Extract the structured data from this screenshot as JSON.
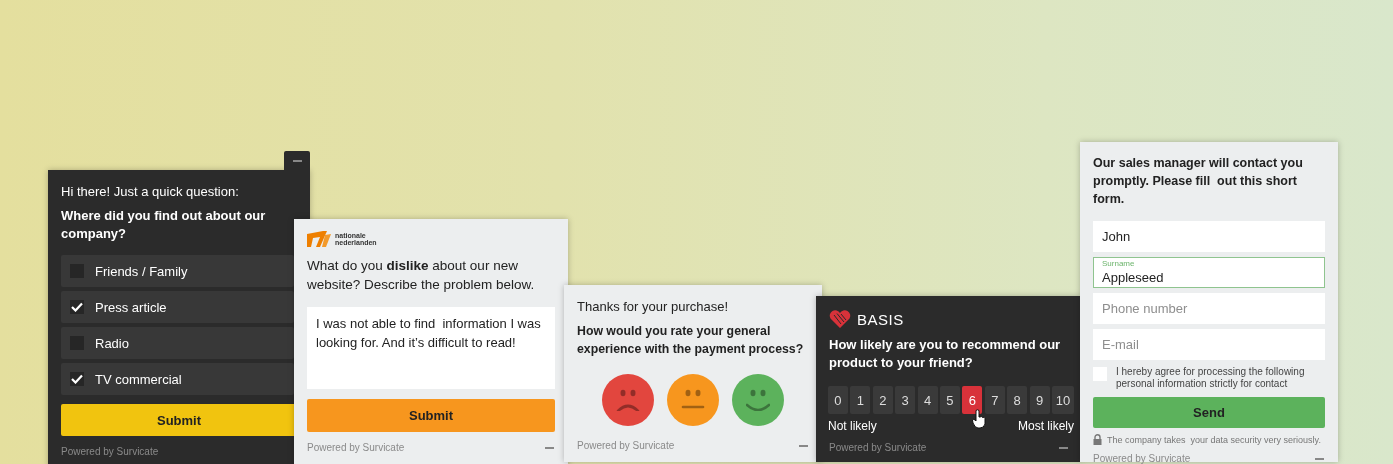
{
  "surveys": [
    {
      "kind": "checkbox",
      "dark": true,
      "color": "#f1c40f",
      "intro": "Hi there! Just a quick question:",
      "question": "Where did you find out about our company?",
      "options": [
        {
          "label": "Friends / Family",
          "checked": false
        },
        {
          "label": "Press article",
          "checked": true
        },
        {
          "label": "Radio",
          "checked": false
        },
        {
          "label": "TV commercial",
          "checked": true
        }
      ],
      "submit": "Submit",
      "footer": "Powered by Survicate"
    },
    {
      "kind": "text",
      "dark": false,
      "color": "#f7961e",
      "logo": [
        "nationale",
        "nederlanden"
      ],
      "question": "What do you **dislike** about our new website? Describe the problem below.",
      "answer": "I was not able to find  information I was looking for. And it’s difficult to read!",
      "submit": "Submit",
      "footer": "Powered by Survicate"
    },
    {
      "kind": "smiley",
      "dark": false,
      "intro": "Thanks for your purchase!",
      "question": "How would you rate your general experience with the payment process?",
      "faces": [
        {
          "kind": "sad",
          "color": "#e2463e"
        },
        {
          "kind": "neutral",
          "color": "#f7961e"
        },
        {
          "kind": "happy",
          "color": "#5cb25c"
        }
      ],
      "footer": "Powered by Survicate"
    },
    {
      "kind": "nps",
      "dark": true,
      "brand": "BASIS",
      "question": "How likely are you to recommend our product to your friend?",
      "scale": [
        {
          "label": "0",
          "selected": false
        },
        {
          "label": "1",
          "selected": false
        },
        {
          "label": "2",
          "selected": false
        },
        {
          "label": "3",
          "selected": false
        },
        {
          "label": "4",
          "selected": false
        },
        {
          "label": "5",
          "selected": false
        },
        {
          "label": "6",
          "selected": true
        },
        {
          "label": "7",
          "selected": false
        },
        {
          "label": "8",
          "selected": false
        },
        {
          "label": "9",
          "selected": false
        },
        {
          "label": "10",
          "selected": false
        }
      ],
      "low_label": "Not likely",
      "high_label": "Most likely",
      "footer": "Powered by Survicate"
    },
    {
      "kind": "form",
      "dark": false,
      "color": "#5cb25c",
      "question": "Our sales manager will contact you promptly. Please fill  out this short form.",
      "fields": [
        {
          "value": "John"
        },
        {
          "label": "Surname",
          "value": "Appleseed"
        },
        {
          "placeholder": "Phone number"
        },
        {
          "placeholder": "E-mail"
        }
      ],
      "consent": {
        "label": "I hereby agree for processing the following personal information strictly for contact",
        "checked": false
      },
      "submit": "Send",
      "security": "The company takes  your data security very seriously.",
      "footer": "Powered by Survicate"
    }
  ]
}
